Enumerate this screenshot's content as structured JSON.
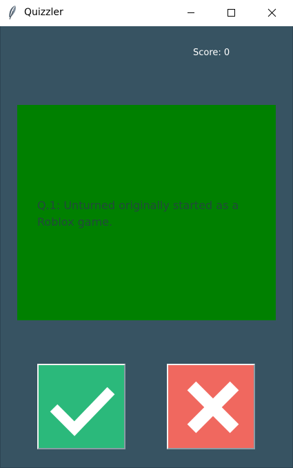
{
  "window": {
    "title": "Quizzler",
    "icon": "feather-icon",
    "controls": [
      "minimize-icon",
      "maximize-icon",
      "close-icon"
    ]
  },
  "score": {
    "text": "Score: 0"
  },
  "question": {
    "text": "Q.1: Unturned originally started as a Roblox game."
  },
  "answers": {
    "true_icon": "checkmark-icon",
    "false_icon": "cross-icon"
  },
  "colors": {
    "background": "#375362",
    "card": "#008000",
    "question_text": "#22493b",
    "true_button": "#2bb97b",
    "false_button": "#f0685f"
  }
}
